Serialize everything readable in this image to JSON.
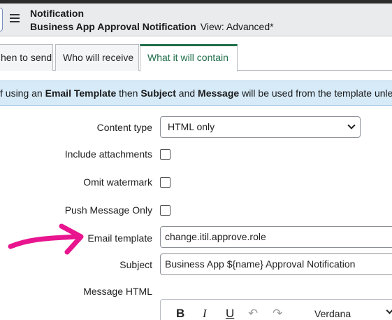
{
  "header": {
    "title": "Notification",
    "record": "Business App Approval Notification",
    "view": "View: Advanced*"
  },
  "tabs": [
    {
      "label": "hen to send",
      "active": false
    },
    {
      "label": "Who will receive",
      "active": false
    },
    {
      "label": "What it will contain",
      "active": true
    }
  ],
  "banner": {
    "prefix": "f using an ",
    "strong1": "Email Template",
    "mid1": " then ",
    "strong2": "Subject",
    "mid2": " and ",
    "strong3": "Message",
    "suffix": " will be used from the template unless ov"
  },
  "form": {
    "content_type_label": "Content type",
    "content_type_value": "HTML only",
    "include_attachments_label": "Include attachments",
    "omit_watermark_label": "Omit watermark",
    "push_message_only_label": "Push Message Only",
    "email_template_label": "Email template",
    "email_template_value": "change.itil.approve.role",
    "subject_label": "Subject",
    "subject_value": "Business App ${name} Approval Notification",
    "message_html_label": "Message HTML"
  },
  "editor": {
    "bold": "B",
    "italic": "I",
    "underline": "U",
    "undo": "↶",
    "redo": "↷",
    "font": "Verdana"
  },
  "colors": {
    "accent_tab": "#1f6e4a",
    "banner_bg": "#d6eaf8",
    "annotation_arrow": "#e8158f"
  }
}
